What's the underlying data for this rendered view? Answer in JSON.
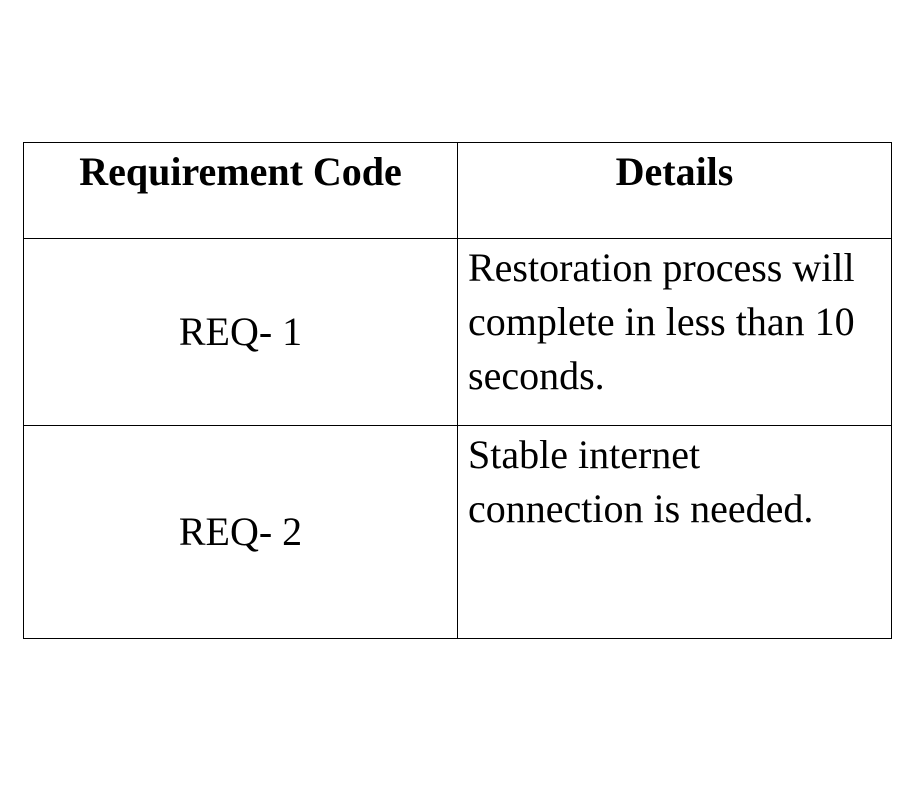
{
  "table": {
    "headers": [
      "Requirement Code",
      "Details"
    ],
    "rows": [
      {
        "code": "REQ- 1",
        "details": "Restoration process will complete in less than 10 seconds."
      },
      {
        "code": "REQ- 2",
        "details": "Stable internet connection is needed."
      }
    ]
  }
}
